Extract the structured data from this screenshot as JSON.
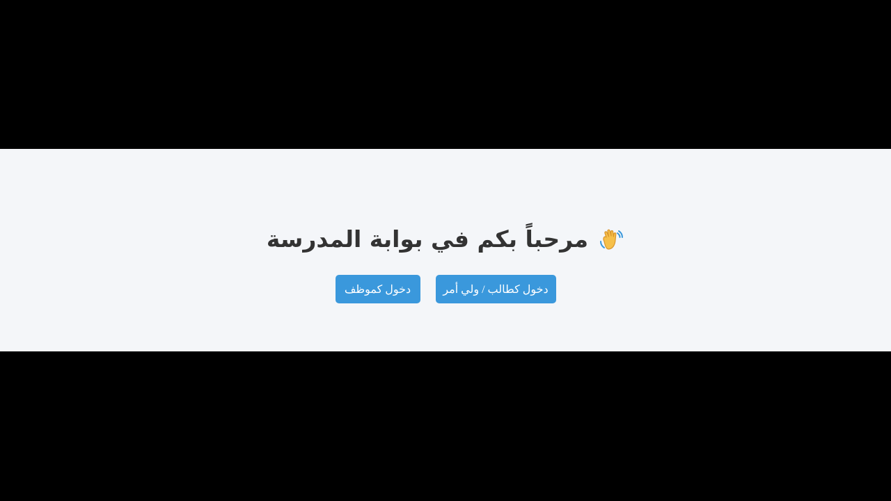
{
  "page": {
    "title": "مرحباً بكم في بوابة المدرسة",
    "icon": "waving-hand-icon"
  },
  "buttons": {
    "student_label": "دخول كطالب / ولي أمر",
    "staff_label": "دخول كموظف"
  },
  "colors": {
    "background_outer": "#000000",
    "page_background": "#f4f6f9",
    "title_text": "#333333",
    "button_bg": "#3a98dc",
    "button_text": "#ffffff"
  }
}
